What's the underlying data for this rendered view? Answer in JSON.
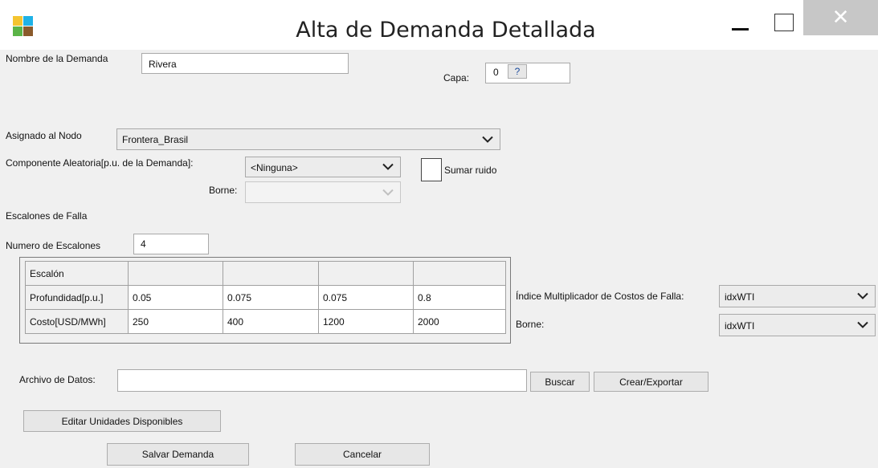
{
  "window": {
    "title": "Alta de Demanda Detallada",
    "close_glyph": "✕",
    "icon": "app-tiles-icon",
    "icon_colors": [
      "#f4c430",
      "#1fb2e6",
      "#5bb447",
      "#8a5a2b"
    ]
  },
  "form": {
    "nombre_label": "Nombre de la Demanda",
    "nombre_value": "Rivera",
    "capa_label": "Capa:",
    "capa_value": "0",
    "capa_help": "?",
    "nodo_label": "Asignado al Nodo",
    "nodo_value": "Frontera_Brasil",
    "componente_label": "Componente Aleatoria[p.u. de la Demanda]:",
    "componente_value": "<Ninguna>",
    "sumar_ruido_label": "Sumar ruido",
    "sumar_ruido_checked": false,
    "borne_label": "Borne:",
    "borne_value": "",
    "escalones_section": "Escalones de Falla",
    "num_escalones_label": "Numero de Escalones",
    "num_escalones_value": "4"
  },
  "table": {
    "header_row": [
      "Escalón",
      "",
      "",
      "",
      ""
    ],
    "rows": [
      [
        "Profundidad[p.u.]",
        "0.05",
        "0.075",
        "0.075",
        "0.8"
      ],
      [
        "Costo[USD/MWh]",
        "250",
        "400",
        "1200",
        "2000"
      ]
    ]
  },
  "indices": {
    "multiplicador_label": "Índice Multiplicador de Costos de Falla:",
    "multiplicador_value": "idxWTI",
    "borne_label": "Borne:",
    "borne_value": "idxWTI"
  },
  "archivo": {
    "label": "Archivo de Datos:",
    "value": "",
    "buscar_label": "Buscar",
    "crear_label": "Crear/Exportar"
  },
  "actions": {
    "editar_label": "Editar Unidades Disponibles",
    "salvar_label": "Salvar Demanda",
    "cancelar_label": "Cancelar"
  }
}
